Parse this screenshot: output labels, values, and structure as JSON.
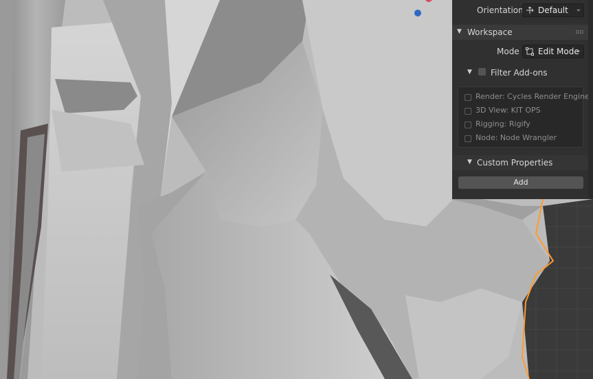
{
  "viewport": {
    "gizmo_colors": {
      "z_axis": "#2f68c0",
      "x_axis": "#d94a5e"
    },
    "selection_outline_color": "#ff9a2e"
  },
  "panel": {
    "orientation": {
      "label": "Orientation",
      "value": "Default"
    },
    "workspace": {
      "header": "Workspace",
      "mode": {
        "label": "Mode",
        "value": "Edit Mode"
      },
      "filter_addons": {
        "label": "Filter Add-ons",
        "checked": false,
        "items": [
          {
            "label": "Render: Cycles Render Engine",
            "checked": false
          },
          {
            "label": "3D View: KIT OPS",
            "checked": false
          },
          {
            "label": "Rigging: Rigify",
            "checked": false
          },
          {
            "label": "Node: Node Wrangler",
            "checked": false
          }
        ]
      }
    },
    "custom_properties": {
      "header": "Custom Properties",
      "add_label": "Add"
    }
  }
}
